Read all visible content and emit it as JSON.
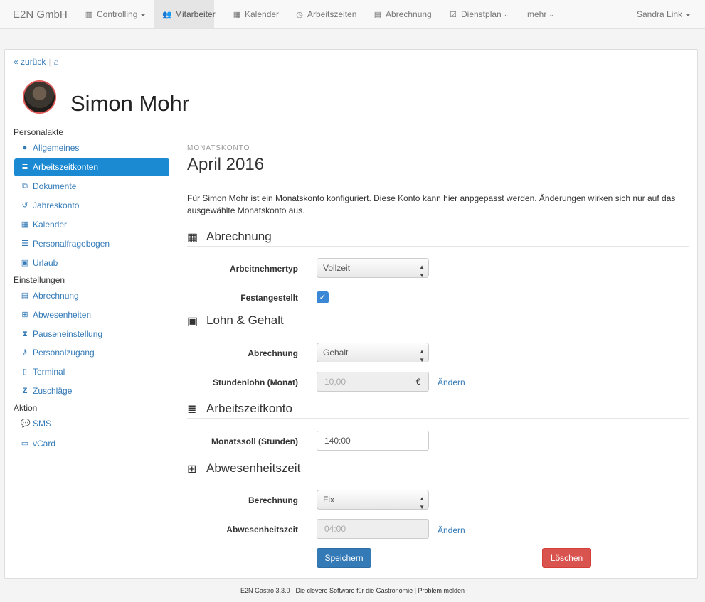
{
  "navbar": {
    "brand": "E2N GmbH",
    "items": [
      {
        "label": "Controlling",
        "icon": "bar-chart-icon"
      },
      {
        "label": "Mitarbeiter",
        "icon": "users-icon"
      },
      {
        "label": "Kalender",
        "icon": "calendar-icon"
      },
      {
        "label": "Arbeitszeiten",
        "icon": "clock-icon"
      },
      {
        "label": "Abrechnung",
        "icon": "calculator-icon"
      },
      {
        "label": "Dienstplan",
        "icon": "calendar-check-icon"
      },
      {
        "label": "mehr",
        "icon": ""
      }
    ],
    "user": "Sandra Link"
  },
  "breadcrumb": {
    "back": "zurück",
    "home_icon": "home-icon"
  },
  "profile": {
    "name": "Simon Mohr"
  },
  "sidebar": {
    "personalakte": {
      "heading": "Personalakte",
      "items": [
        {
          "label": "Allgemeines",
          "icon": "user-icon"
        },
        {
          "label": "Arbeitszeitkonten",
          "icon": "database-icon"
        },
        {
          "label": "Dokumente",
          "icon": "documents-icon"
        },
        {
          "label": "Jahreskonto",
          "icon": "history-icon"
        },
        {
          "label": "Kalender",
          "icon": "calendar-icon"
        },
        {
          "label": "Personalfragebogen",
          "icon": "list-icon"
        },
        {
          "label": "Urlaub",
          "icon": "suitcase-icon"
        }
      ]
    },
    "einstellungen": {
      "heading": "Einstellungen",
      "items": [
        {
          "label": "Abrechnung",
          "icon": "calculator-icon"
        },
        {
          "label": "Abwesenheiten",
          "icon": "calendar-plus-icon"
        },
        {
          "label": "Pauseneinstellung",
          "icon": "hourglass-icon"
        },
        {
          "label": "Personalzugang",
          "icon": "key-icon"
        },
        {
          "label": "Terminal",
          "icon": "tablet-icon"
        },
        {
          "label": "Zuschläge",
          "icon": "z-icon"
        }
      ]
    },
    "aktion": {
      "heading": "Aktion",
      "items": [
        {
          "label": "SMS",
          "icon": "chat-icon"
        },
        {
          "label": "vCard",
          "icon": "card-icon"
        }
      ]
    }
  },
  "main": {
    "eyebrow": "MONATSKONTO",
    "month": "April 2016",
    "description": "Für Simon Mohr ist ein Monatskonto konfiguriert. Diese Konto kann hier anpgepasst werden. Änderungen wirken sich nur auf das ausgewählte Monatskonto aus.",
    "sections": {
      "abrechnung": {
        "title": "Abrechnung",
        "arbeitnehmertyp_label": "Arbeitnehmertyp",
        "arbeitnehmertyp_value": "Vollzeit",
        "festangestellt_label": "Festangestellt",
        "festangestellt_checked": true
      },
      "lohn": {
        "title": "Lohn & Gehalt",
        "abrechnung_label": "Abrechnung",
        "abrechnung_value": "Gehalt",
        "stundenlohn_label": "Stundenlohn (Monat)",
        "stundenlohn_value": "10,00",
        "currency": "€",
        "change_link": "Ändern"
      },
      "arbeitszeitkonto": {
        "title": "Arbeitszeitkonto",
        "monatssoll_label": "Monatssoll (Stunden)",
        "monatssoll_value": "140:00"
      },
      "abwesenheitszeit": {
        "title": "Abwesenheitszeit",
        "berechnung_label": "Berechnung",
        "berechnung_value": "Fix",
        "abwesenheitszeit_label": "Abwesenheitszeit",
        "abwesenheitszeit_value": "04:00",
        "change_link": "Ändern"
      }
    },
    "buttons": {
      "save": "Speichern",
      "delete": "Löschen"
    }
  },
  "footer": {
    "text": "E2N Gastro 3.3.0 · Die clevere Software für die Gastronomie | Problem melden"
  },
  "colors": {
    "accent": "#1b8ad3",
    "primary": "#337ab7",
    "danger": "#d9534f"
  }
}
